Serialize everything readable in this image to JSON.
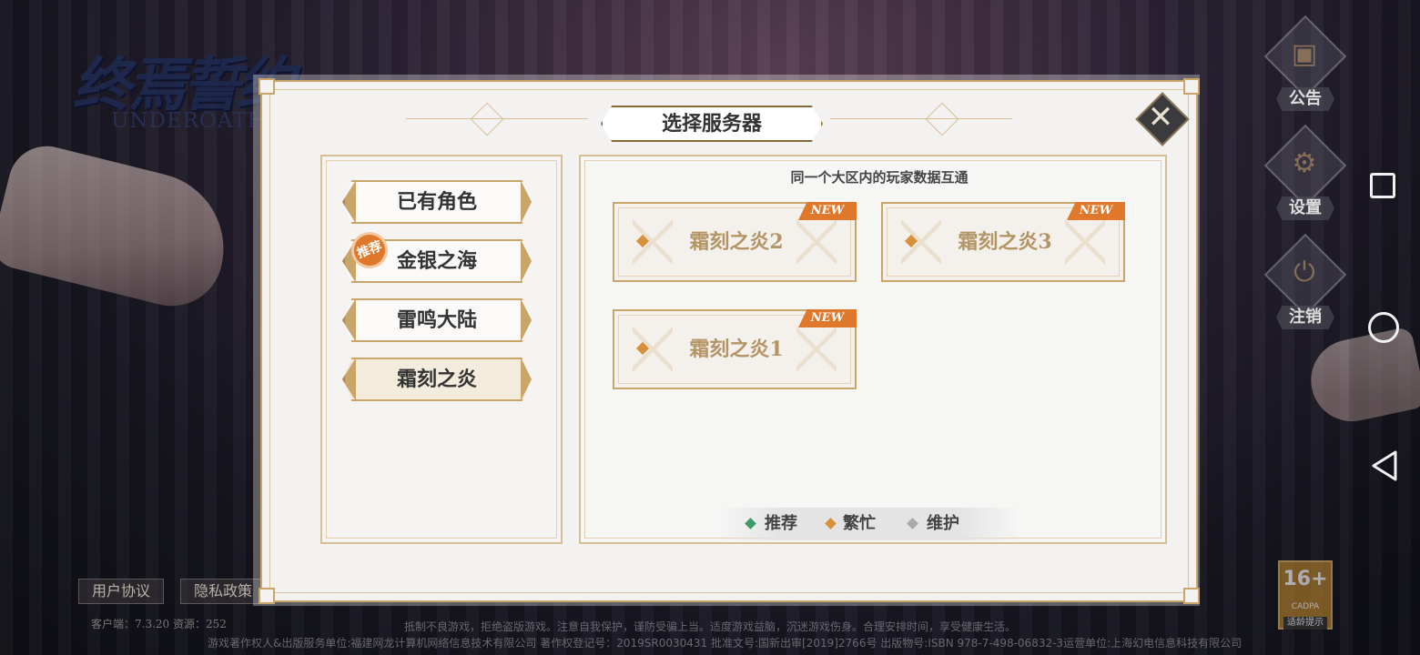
{
  "logo": {
    "title_cn": "终焉誓约",
    "title_en": "UNDEROATH"
  },
  "side_menu": [
    {
      "label": "公告",
      "icon": "announcement-icon"
    },
    {
      "label": "设置",
      "icon": "gear-icon"
    },
    {
      "label": "注销",
      "icon": "power-icon"
    }
  ],
  "dialog": {
    "title": "选择服务器",
    "close_icon": "close-icon",
    "regions": [
      {
        "label": "已有角色",
        "selected": false,
        "badge": ""
      },
      {
        "label": "金银之海",
        "selected": false,
        "badge": "推荐"
      },
      {
        "label": "雷鸣大陆",
        "selected": false,
        "badge": ""
      },
      {
        "label": "霜刻之炎",
        "selected": true,
        "badge": ""
      }
    ],
    "server_panel": {
      "description": "同一个大区内的玩家数据互通",
      "servers": [
        {
          "name": "霜刻之炎2",
          "tag": "NEW",
          "status": "busy"
        },
        {
          "name": "霜刻之炎3",
          "tag": "NEW",
          "status": "busy"
        },
        {
          "name": "霜刻之炎1",
          "tag": "NEW",
          "status": "busy"
        }
      ]
    },
    "legend": [
      {
        "label": "推荐",
        "color": "#3f9a6a"
      },
      {
        "label": "繁忙",
        "color": "#d9903a"
      },
      {
        "label": "维护",
        "color": "#a9a9a9"
      }
    ]
  },
  "footer": {
    "user_agreement": "用户协议",
    "privacy_policy": "隐私政策",
    "version": "客户端：7.3.20  资源：252",
    "notice_line1": "抵制不良游戏，拒绝盗版游戏。注意自我保护，谨防受骗上当。适度游戏益脑，沉迷游戏伤身。合理安排时间，享受健康生活。",
    "notice_line2": "游戏著作权人&出版服务单位:福建网龙计算机网络信息技术有限公司  著作权登记号：2019SR0030431  批准文号:国新出审[2019]2766号  出版物号:ISBN 978-7-498-06832-3运营单位:上海幻电信息科技有限公司",
    "age_rating": {
      "number": "16+",
      "org": "CADPA",
      "label": "适龄提示"
    }
  },
  "colors": {
    "gold": "#c9a56a",
    "new_orange": "#e0782c",
    "server_text": "#b39565"
  }
}
